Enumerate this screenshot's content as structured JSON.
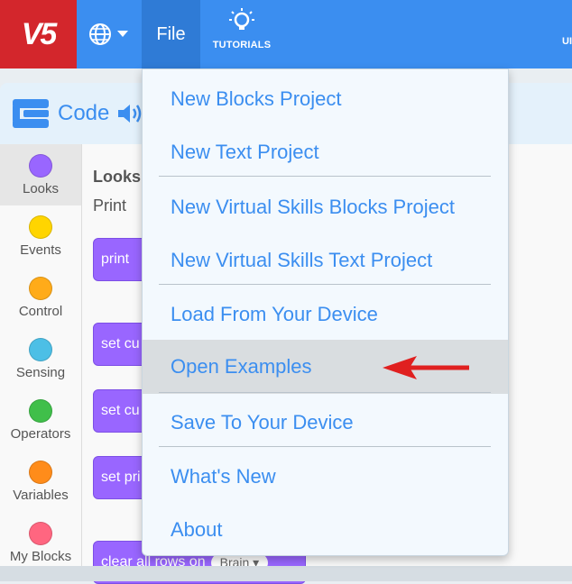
{
  "header": {
    "logo_text": "V5",
    "file_label": "File",
    "tutorials_label": "TUTORIALS",
    "right_partial": "UI"
  },
  "code_tab": {
    "label": "Code"
  },
  "categories": [
    {
      "name": "Looks",
      "color": "#9966ff",
      "selected": true
    },
    {
      "name": "Events",
      "color": "#ffd500",
      "selected": false
    },
    {
      "name": "Control",
      "color": "#ffab19",
      "selected": false
    },
    {
      "name": "Sensing",
      "color": "#4cbfe6",
      "selected": false
    },
    {
      "name": "Operators",
      "color": "#40bf4a",
      "selected": false
    },
    {
      "name": "Variables",
      "color": "#ff8c1a",
      "selected": false
    },
    {
      "name": "My Blocks",
      "color": "#ff6680",
      "selected": false
    }
  ],
  "palette": {
    "heading": "Looks",
    "subheading": "Print",
    "blocks": [
      {
        "label": "print",
        "value": ""
      },
      {
        "label": "set cu",
        "value": ""
      },
      {
        "label": "set cu",
        "value": ""
      },
      {
        "label": "set pri",
        "value": ""
      },
      {
        "label": "clear all rows on",
        "value": "Brain ▾"
      }
    ]
  },
  "menu": {
    "items": [
      "New Blocks Project",
      "New Text Project",
      "New Virtual Skills Blocks Project",
      "New Virtual Skills Text Project",
      "Load From Your Device",
      "Open Examples",
      "Save To Your Device",
      "What's New",
      "About"
    ],
    "highlighted_index": 5
  },
  "colors": {
    "topbar": "#3b8ef0",
    "logo_bg": "#d3262c",
    "menu_text": "#3b8ef0",
    "arrow": "#e02020"
  }
}
